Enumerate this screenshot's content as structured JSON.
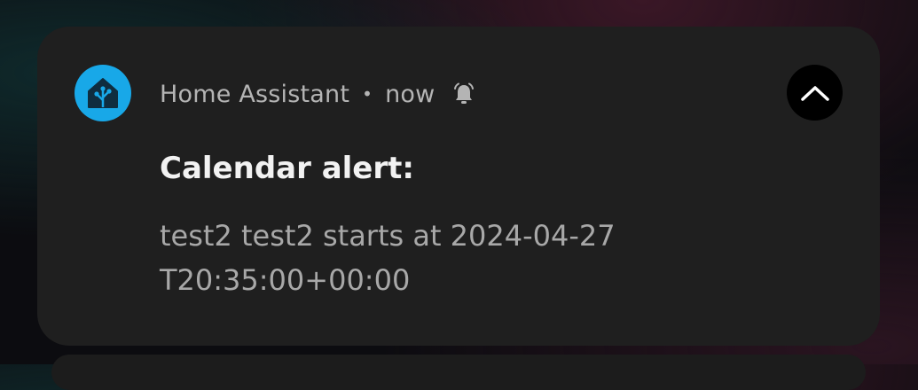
{
  "notification": {
    "app_name": "Home Assistant",
    "separator": "•",
    "time": "now",
    "title": "Calendar alert:",
    "message": "test2 test2 starts at 2024-04-27T20:35:00+00:00",
    "icons": {
      "app": "home-assistant-icon",
      "alert": "bell-icon",
      "collapse": "chevron-up-icon"
    },
    "colors": {
      "app_icon_bg": "#18a8e8",
      "card_bg": "#1f1f1f",
      "title": "#f2f2f2",
      "secondary_text": "#b4b4b4"
    }
  }
}
